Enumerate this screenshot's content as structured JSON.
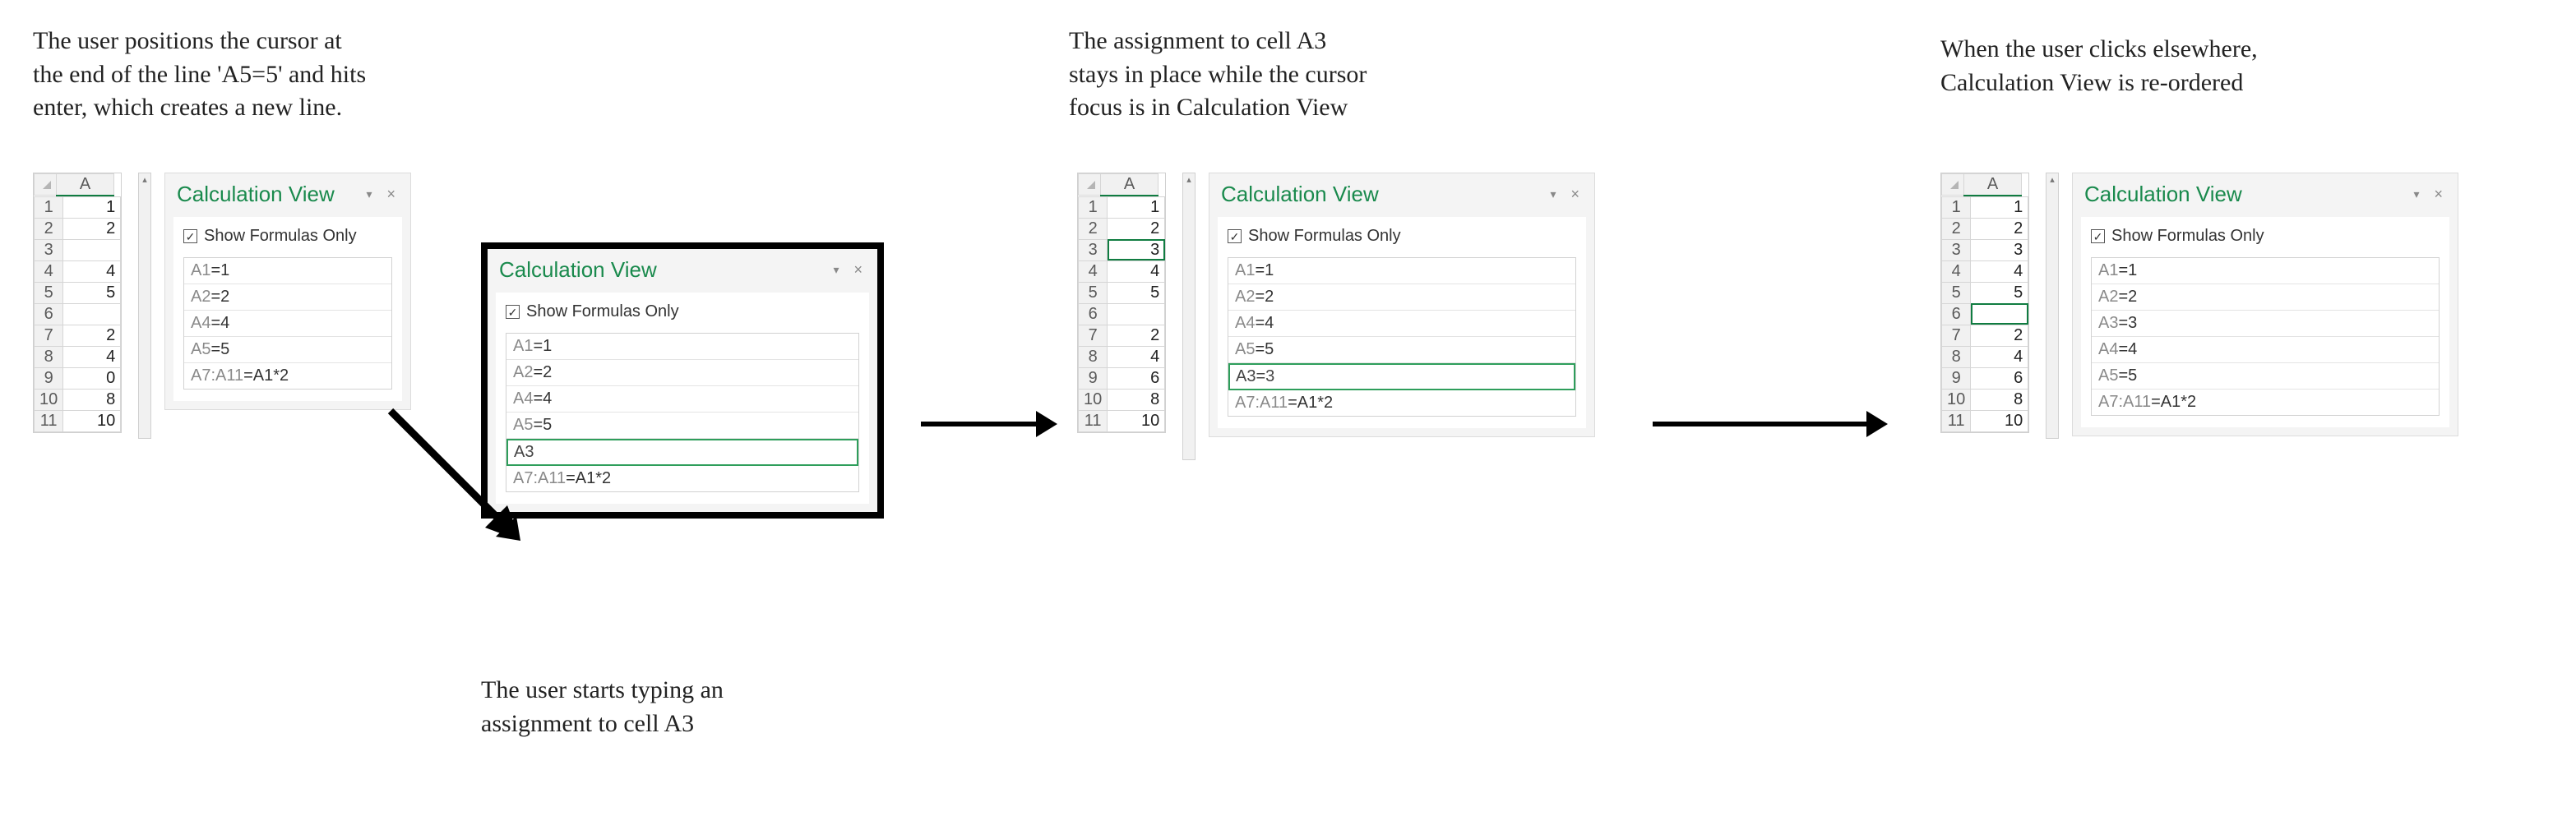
{
  "captions": {
    "step1": "The user positions the cursor at\nthe end of the line 'A5=5' and hits\nenter, which creates a new line.",
    "step1b": "The user starts typing an\nassignment to cell A3",
    "step2": "The assignment to cell A3\nstays in place while the cursor\nfocus is in Calculation View",
    "step3": "When the user clicks elsewhere,\nCalculation View is re-ordered"
  },
  "calcview": {
    "title": "Calculation View",
    "checkbox_label": "Show Formulas Only",
    "checked_glyph": "✓",
    "dropdown_glyph": "▾",
    "close_glyph": "×"
  },
  "col_header": "A",
  "panel1": {
    "grid": {
      "rows": [
        {
          "r": "1",
          "v": "1"
        },
        {
          "r": "2",
          "v": "2"
        },
        {
          "r": "3",
          "v": ""
        },
        {
          "r": "4",
          "v": "4"
        },
        {
          "r": "5",
          "v": "5"
        },
        {
          "r": "6",
          "v": ""
        },
        {
          "r": "7",
          "v": "2"
        },
        {
          "r": "8",
          "v": "4"
        },
        {
          "r": "9",
          "v": "0"
        },
        {
          "r": "10",
          "v": "8"
        },
        {
          "r": "11",
          "v": "10"
        }
      ]
    },
    "formulas": [
      {
        "lhs": "A1",
        "rhs": "=1"
      },
      {
        "lhs": "A2",
        "rhs": "=2"
      },
      {
        "lhs": "A4",
        "rhs": "=4"
      },
      {
        "lhs": "A5",
        "rhs": "=5"
      },
      {
        "lhs": "A7:A11",
        "rhs": "=A1*2"
      }
    ],
    "popup_formulas": [
      {
        "lhs": "A1",
        "rhs": "=1",
        "active": false
      },
      {
        "lhs": "A2",
        "rhs": "=2",
        "active": false
      },
      {
        "lhs": "A4",
        "rhs": "=4",
        "active": false
      },
      {
        "lhs": "A5",
        "rhs": "=5",
        "active": false
      },
      {
        "lhs": "A3",
        "rhs": "",
        "active": true
      },
      {
        "lhs": "A7:A11",
        "rhs": "=A1*2",
        "active": false
      }
    ]
  },
  "panel2": {
    "grid": {
      "selected_row": "3",
      "rows": [
        {
          "r": "1",
          "v": "1"
        },
        {
          "r": "2",
          "v": "2"
        },
        {
          "r": "3",
          "v": "3",
          "selected": true
        },
        {
          "r": "4",
          "v": "4"
        },
        {
          "r": "5",
          "v": "5"
        },
        {
          "r": "6",
          "v": ""
        },
        {
          "r": "7",
          "v": "2"
        },
        {
          "r": "8",
          "v": "4"
        },
        {
          "r": "9",
          "v": "6"
        },
        {
          "r": "10",
          "v": "8"
        },
        {
          "r": "11",
          "v": "10"
        }
      ]
    },
    "formulas": [
      {
        "lhs": "A1",
        "rhs": "=1",
        "active": false
      },
      {
        "lhs": "A2",
        "rhs": "=2",
        "active": false
      },
      {
        "lhs": "A4",
        "rhs": "=4",
        "active": false
      },
      {
        "lhs": "A5",
        "rhs": "=5",
        "active": false
      },
      {
        "lhs": "A3",
        "rhs": "=3",
        "active": true
      },
      {
        "lhs": "A7:A11",
        "rhs": "=A1*2",
        "active": false
      }
    ]
  },
  "panel3": {
    "grid": {
      "selected_row": "6",
      "rows": [
        {
          "r": "1",
          "v": "1"
        },
        {
          "r": "2",
          "v": "2"
        },
        {
          "r": "3",
          "v": "3"
        },
        {
          "r": "4",
          "v": "4"
        },
        {
          "r": "5",
          "v": "5"
        },
        {
          "r": "6",
          "v": "",
          "selected": true
        },
        {
          "r": "7",
          "v": "2"
        },
        {
          "r": "8",
          "v": "4"
        },
        {
          "r": "9",
          "v": "6"
        },
        {
          "r": "10",
          "v": "8"
        },
        {
          "r": "11",
          "v": "10"
        }
      ]
    },
    "formulas": [
      {
        "lhs": "A1",
        "rhs": "=1"
      },
      {
        "lhs": "A2",
        "rhs": "=2"
      },
      {
        "lhs": "A3",
        "rhs": "=3"
      },
      {
        "lhs": "A4",
        "rhs": "=4"
      },
      {
        "lhs": "A5",
        "rhs": "=5"
      },
      {
        "lhs": "A7:A11",
        "rhs": "=A1*2"
      }
    ]
  }
}
